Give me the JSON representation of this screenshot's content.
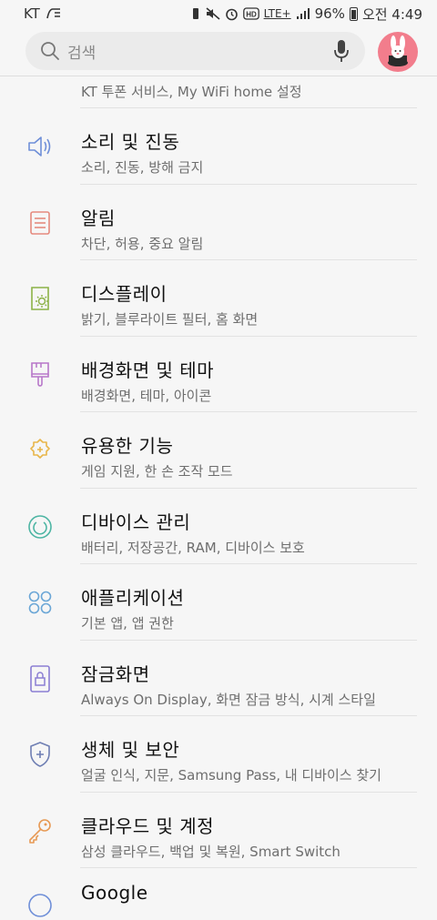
{
  "status_bar": {
    "carrier": "KT",
    "battery": "96%",
    "time": "오전 4:49",
    "network": "LTE+"
  },
  "search": {
    "placeholder": "검색"
  },
  "settings": [
    {
      "title": "",
      "subtitle": "KT 투폰 서비스, My WiFi home 설정",
      "icon": "connections-icon"
    },
    {
      "title": "소리 및 진동",
      "subtitle": "소리, 진동, 방해 금지",
      "icon": "speaker-icon",
      "color": "#6f8fd8"
    },
    {
      "title": "알림",
      "subtitle": "차단, 허용, 중요 알림",
      "icon": "notification-icon",
      "color": "#e58a7e"
    },
    {
      "title": "디스플레이",
      "subtitle": "밝기, 블루라이트 필터, 홈 화면",
      "icon": "display-icon",
      "color": "#8cb246"
    },
    {
      "title": "배경화면 및 테마",
      "subtitle": "배경화면, 테마, 아이콘",
      "icon": "paintbrush-icon",
      "color": "#b777c9"
    },
    {
      "title": "유용한 기능",
      "subtitle": "게임 지원, 한 손 조작 모드",
      "icon": "puzzle-gear-icon",
      "color": "#e8b64a"
    },
    {
      "title": "디바이스 관리",
      "subtitle": "배터리, 저장공간, RAM, 디바이스 보호",
      "icon": "device-care-icon",
      "color": "#4db5a3"
    },
    {
      "title": "애플리케이션",
      "subtitle": "기본 앱, 앱 권한",
      "icon": "apps-icon",
      "color": "#6aa6d6"
    },
    {
      "title": "잠금화면",
      "subtitle": "Always On Display, 화면 잠금 방식, 시계 스타일",
      "icon": "lock-screen-icon",
      "color": "#8b7fd3"
    },
    {
      "title": "생체 및 보안",
      "subtitle": "얼굴 인식, 지문, Samsung Pass, 내 디바이스 찾기",
      "icon": "shield-icon",
      "color": "#6f7fb3"
    },
    {
      "title": "클라우드 및 계정",
      "subtitle": "삼성 클라우드, 백업 및 복원, Smart Switch",
      "icon": "key-icon",
      "color": "#e79a55"
    },
    {
      "title": "Google",
      "subtitle": "",
      "icon": "google-icon",
      "color": "#6f8fd8"
    }
  ]
}
